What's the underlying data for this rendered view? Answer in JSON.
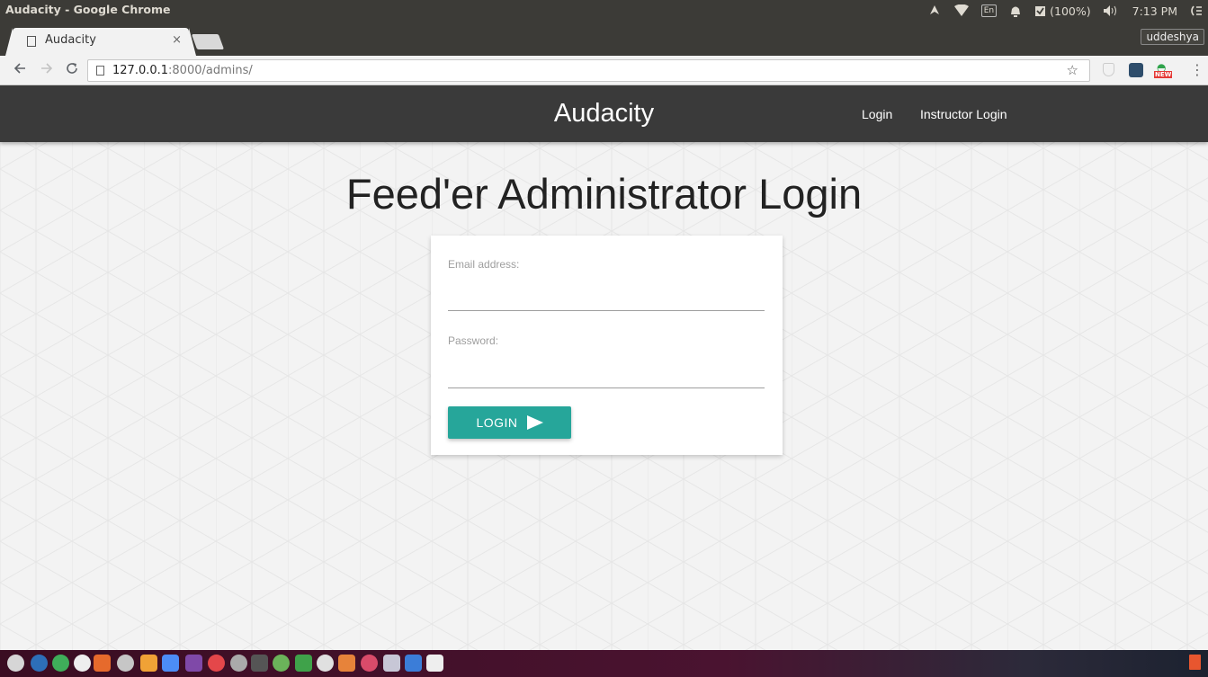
{
  "window": {
    "title": "Audacity - Google Chrome",
    "tray": {
      "keyboard_layout": "En",
      "battery": "(100%)",
      "time": "7:13 PM",
      "user": "uddeshya"
    }
  },
  "browser": {
    "tab_title": "Audacity",
    "tab_close": "×",
    "url_host": "127.0.0.1",
    "url_path": ":8000/admins/",
    "ext_new_badge": "NEW",
    "icons": [
      "back-arrow-icon",
      "forward-arrow-icon",
      "reload-icon",
      "page-icon",
      "star-icon",
      "shield-extension-icon",
      "box-extension-icon",
      "new-extension-icon",
      "more-menu-icon"
    ]
  },
  "site": {
    "brand": "Audacity",
    "nav": {
      "login": "Login",
      "instructor_login": "Instructor Login"
    },
    "heading": "Feed'er Administrator Login",
    "form": {
      "email_label": "Email address:",
      "email_value": "",
      "password_label": "Password:",
      "password_value": "",
      "submit_label": "LOGIN"
    }
  },
  "colors": {
    "nav_bg": "#3a3a3a",
    "button": "#26a69a",
    "page_bg": "#f3f3f3"
  }
}
